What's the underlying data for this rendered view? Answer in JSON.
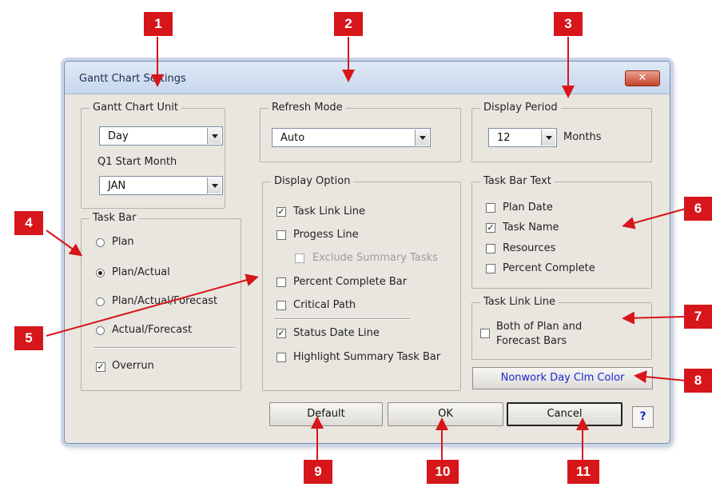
{
  "dialog": {
    "title": "Gantt Chart Settings",
    "close_label": "✕"
  },
  "gantt_unit": {
    "legend": "Gantt Chart Unit",
    "unit_value": "Day",
    "q1_label": "Q1 Start Month",
    "q1_value": "JAN"
  },
  "refresh": {
    "legend": "Refresh Mode",
    "value": "Auto"
  },
  "display_period": {
    "legend": "Display Period",
    "value": "12",
    "unit": "Months"
  },
  "task_bar": {
    "legend": "Task Bar",
    "options": [
      {
        "label": "Plan",
        "selected": false
      },
      {
        "label": "Plan/Actual",
        "selected": true
      },
      {
        "label": "Plan/Actual/Forecast",
        "selected": false
      },
      {
        "label": "Actual/Forecast",
        "selected": false
      }
    ],
    "overrun": {
      "label": "Overrun",
      "checked": true
    }
  },
  "display_option": {
    "legend": "Display Option",
    "items": [
      {
        "label": "Task Link Line",
        "checked": true
      },
      {
        "label": "Progess Line",
        "checked": false
      },
      {
        "label": "Exclude Summary Tasks",
        "checked": false,
        "disabled": true
      },
      {
        "label": "Percent Complete Bar",
        "checked": false
      },
      {
        "label": "Critical Path",
        "checked": false
      },
      {
        "label": "Status Date Line",
        "checked": true
      },
      {
        "label": "Highlight Summary Task Bar",
        "checked": false
      }
    ]
  },
  "task_bar_text": {
    "legend": "Task Bar Text",
    "items": [
      {
        "label": "Plan Date",
        "checked": false
      },
      {
        "label": "Task Name",
        "checked": true
      },
      {
        "label": "Resources",
        "checked": false
      },
      {
        "label": "Percent Complete",
        "checked": false
      }
    ]
  },
  "task_link_line": {
    "legend": "Task Link Line",
    "line1": "Both of Plan and",
    "line2": "Forecast Bars",
    "checked": false
  },
  "buttons": {
    "nonwork": "Nonwork Day Clm Color",
    "default": "Default",
    "ok": "OK",
    "cancel": "Cancel",
    "help": "?"
  },
  "callouts": [
    "1",
    "2",
    "3",
    "4",
    "5",
    "6",
    "7",
    "8",
    "9",
    "10",
    "11"
  ],
  "colors": {
    "callout": "#d6161a",
    "link_blue": "#1a2ad0"
  }
}
